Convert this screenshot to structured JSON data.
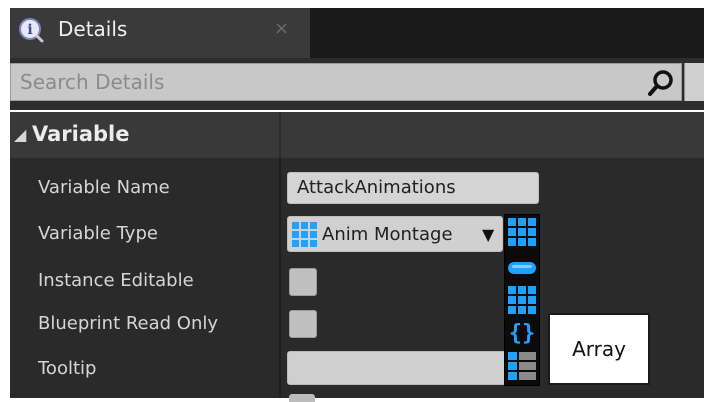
{
  "tab": {
    "title": "Details",
    "close_glyph": "×",
    "icon": "details-info-icon"
  },
  "search": {
    "placeholder": "Search Details",
    "icon": "search-icon"
  },
  "category": {
    "arrow_glyph": "◢",
    "label": "Variable"
  },
  "properties": {
    "variable_name": {
      "label": "Variable Name",
      "value": "AttackAnimations"
    },
    "variable_type": {
      "label": "Variable Type",
      "value": "Anim Montage",
      "arrow_glyph": "▼"
    },
    "instance_editable": {
      "label": "Instance Editable",
      "checked": false
    },
    "blueprint_read_only": {
      "label": "Blueprint Read Only",
      "checked": false
    },
    "tooltip": {
      "label": "Tooltip",
      "value": ""
    }
  },
  "container_picker": {
    "items": [
      "array-grid-icon",
      "single-variable-icon",
      "set-grid-icon",
      "map-braces-icon"
    ]
  },
  "hover_tooltip": {
    "text": "Array"
  },
  "colors": {
    "accent_blue": "#1ea1ff",
    "panel_bg": "#2a2a2a",
    "header_bg": "#393939"
  }
}
